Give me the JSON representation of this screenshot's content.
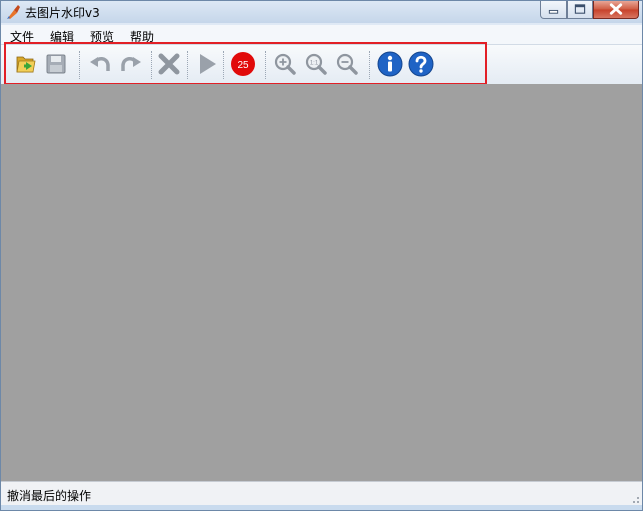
{
  "window": {
    "title": "去图片水印v3",
    "app_icon": "brush-icon",
    "controls": [
      "minimize-icon",
      "maximize-icon",
      "close-icon"
    ]
  },
  "menubar": {
    "items": [
      {
        "label": "文件"
      },
      {
        "label": "编辑"
      },
      {
        "label": "预览"
      },
      {
        "label": "帮助"
      }
    ]
  },
  "toolbar": {
    "buttons": [
      {
        "icon": "open-folder-icon"
      },
      {
        "icon": "save-icon"
      },
      {
        "icon": "undo-icon"
      },
      {
        "icon": "redo-icon"
      },
      {
        "icon": "delete-icon"
      },
      {
        "icon": "play-icon"
      },
      {
        "icon": "brush-size-icon",
        "label": "25"
      },
      {
        "icon": "zoom-in-icon"
      },
      {
        "icon": "zoom-actual-size-icon",
        "label": "1:1"
      },
      {
        "icon": "zoom-out-icon"
      },
      {
        "icon": "info-icon"
      },
      {
        "icon": "help-icon"
      }
    ],
    "highlight_color": "#e21f26"
  },
  "canvas": {
    "background": "#a0a0a0"
  },
  "statusbar": {
    "text": "撤消最后的操作"
  }
}
